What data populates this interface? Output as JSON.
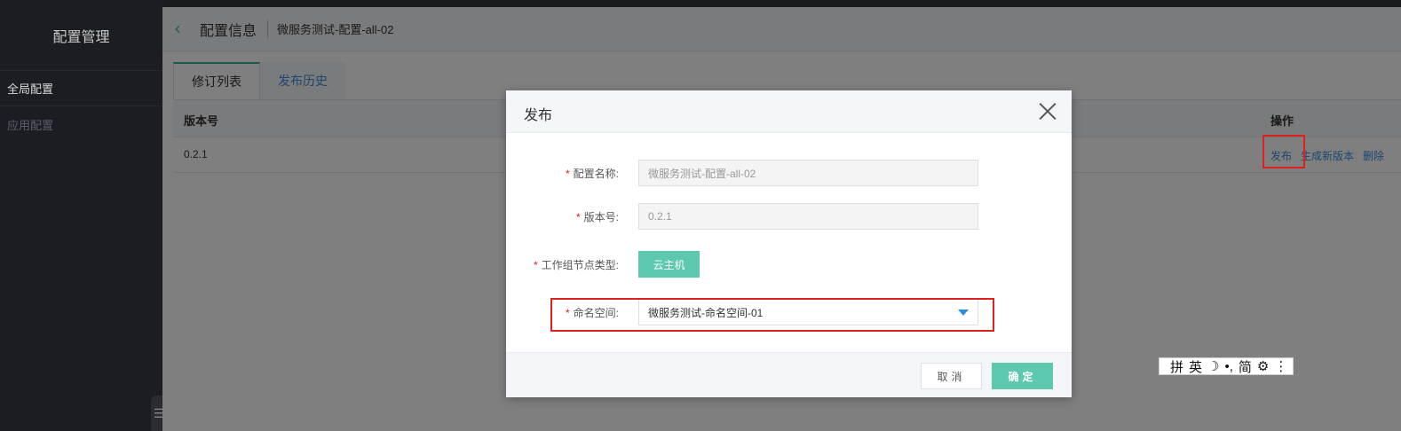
{
  "sidebar": {
    "title": "配置管理",
    "items": [
      {
        "label": "全局配置"
      },
      {
        "label": "应用配置"
      }
    ]
  },
  "header": {
    "title": "配置信息",
    "subtitle": "微服务测试-配置-all-02"
  },
  "tabs": [
    {
      "label": "修订列表"
    },
    {
      "label": "发布历史"
    }
  ],
  "table": {
    "columns": [
      "版本号",
      "操作"
    ],
    "rows": [
      {
        "version": "0.2.1",
        "actions": [
          "发布",
          "生成新版本",
          "删除"
        ]
      }
    ]
  },
  "modal": {
    "title": "发布",
    "fields": {
      "config_name": {
        "label": "配置名称:",
        "value": "微服务测试-配置-all-02"
      },
      "version": {
        "label": "版本号:",
        "value": "0.2.1"
      },
      "node_type": {
        "label": "工作组节点类型:",
        "value": "云主机"
      },
      "namespace": {
        "label": "命名空间:",
        "value": "微服务测试-命名空间-01"
      }
    },
    "cancel_label": "取消",
    "ok_label": "确定",
    "required_mark": "*"
  },
  "ime": {
    "items": [
      "拼",
      "英",
      "☽",
      "•,",
      "简",
      "⚙",
      "⋮"
    ]
  },
  "colors": {
    "accent": "#5cc8ad",
    "link": "#3c8dde",
    "highlight": "#e0201c"
  }
}
